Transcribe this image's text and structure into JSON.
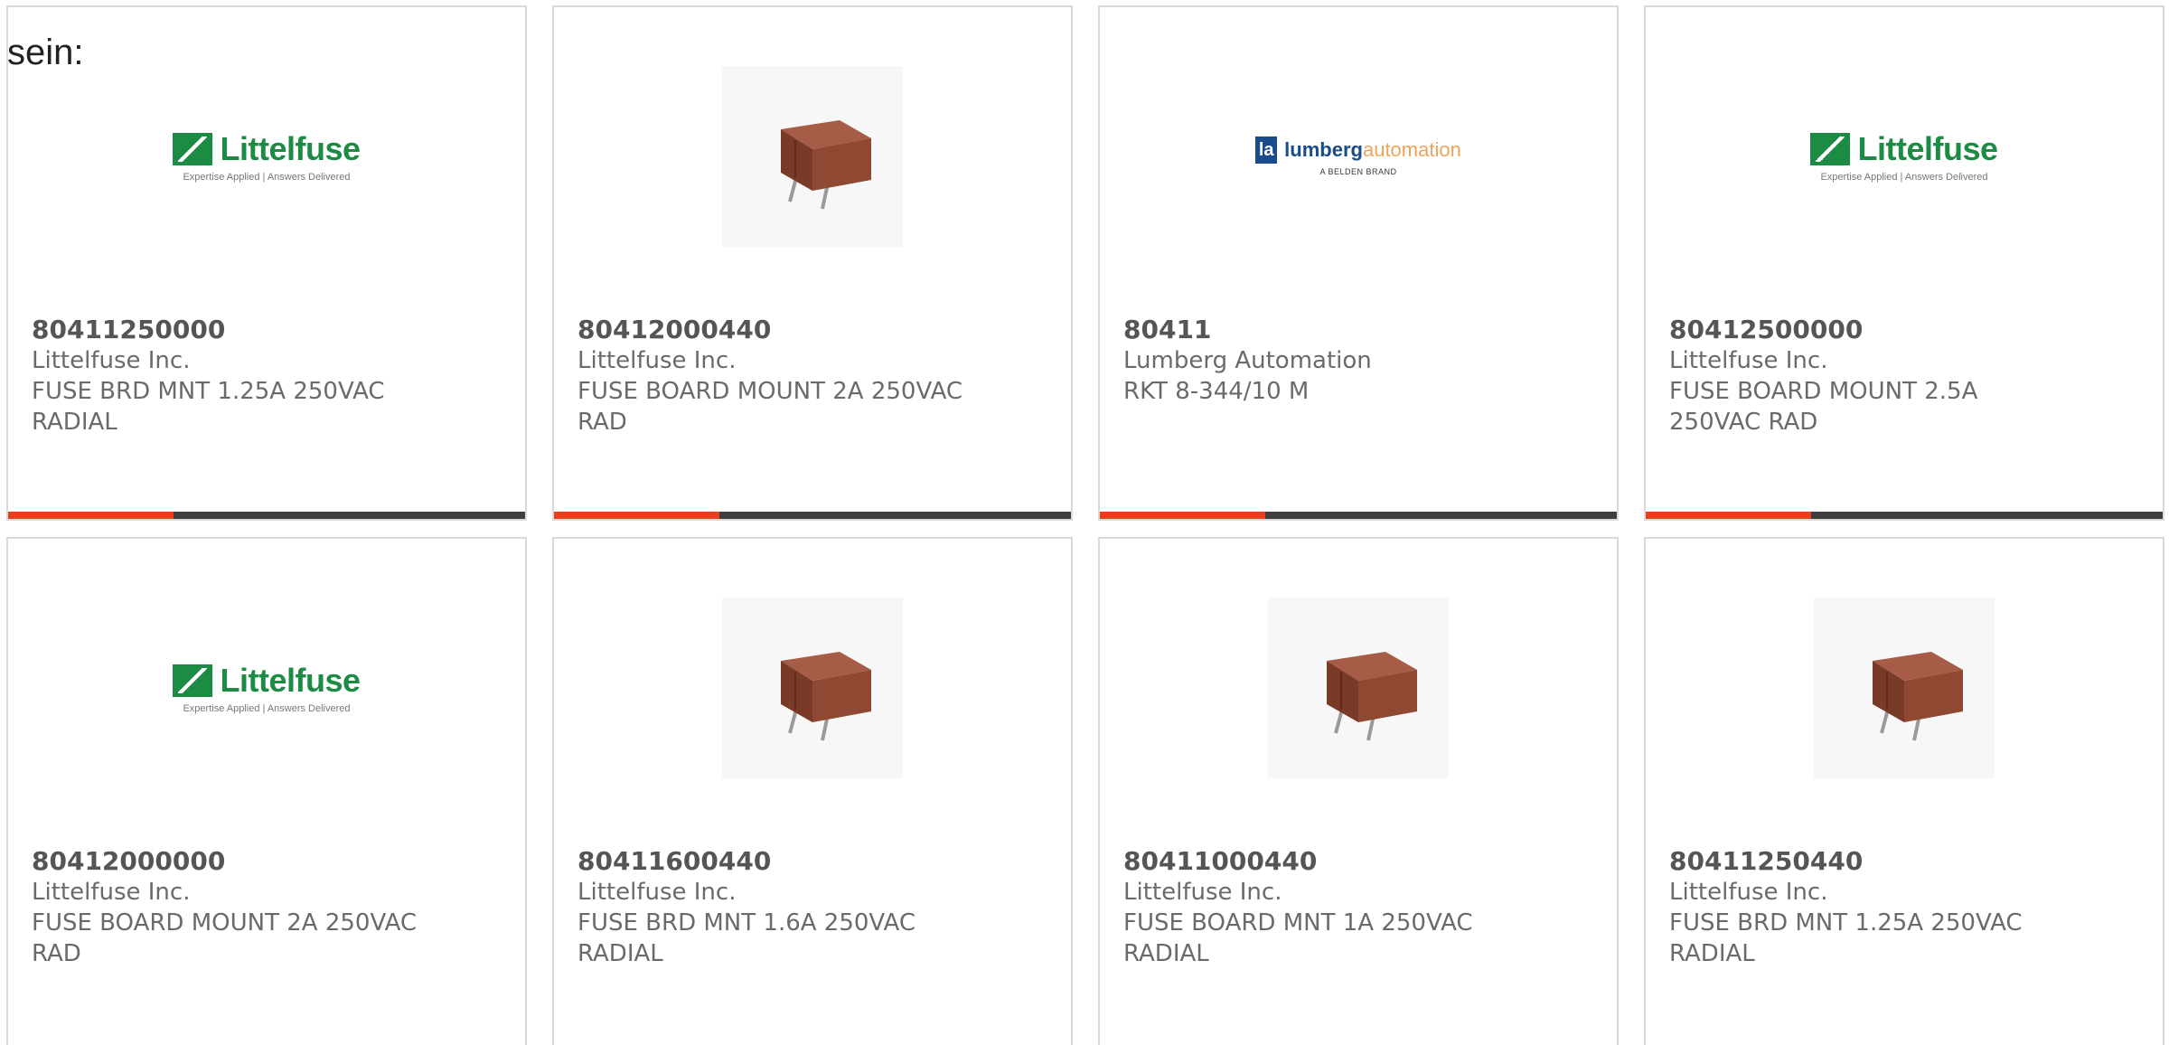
{
  "intro_text": "sein:",
  "accent_color": "#e8401c",
  "bar_color": "#3f3f3f",
  "products": [
    {
      "part": "80411250000",
      "maker": "Littelfuse Inc.",
      "desc_line1": "FUSE BRD MNT 1.25A 250VAC",
      "desc_line2": "RADIAL",
      "image": "littelfuse-logo"
    },
    {
      "part": "80412000440",
      "maker": "Littelfuse Inc.",
      "desc_line1": "FUSE BOARD MOUNT 2A 250VAC",
      "desc_line2": "RAD",
      "image": "fuse-photo"
    },
    {
      "part": "80411",
      "maker": "Lumberg Automation",
      "desc_line1": "RKT 8-344/10 M",
      "desc_line2": "",
      "image": "lumberg-logo"
    },
    {
      "part": "80412500000",
      "maker": "Littelfuse Inc.",
      "desc_line1": "FUSE BOARD MOUNT 2.5A",
      "desc_line2": "250VAC RAD",
      "image": "littelfuse-logo"
    },
    {
      "part": "80412000000",
      "maker": "Littelfuse Inc.",
      "desc_line1": "FUSE BOARD MOUNT 2A 250VAC",
      "desc_line2": "RAD",
      "image": "littelfuse-logo"
    },
    {
      "part": "80411600440",
      "maker": "Littelfuse Inc.",
      "desc_line1": "FUSE BRD MNT 1.6A 250VAC",
      "desc_line2": "RADIAL",
      "image": "fuse-photo"
    },
    {
      "part": "80411000440",
      "maker": "Littelfuse Inc.",
      "desc_line1": "FUSE BOARD MNT 1A 250VAC",
      "desc_line2": "RADIAL",
      "image": "fuse-photo"
    },
    {
      "part": "80411250440",
      "maker": "Littelfuse Inc.",
      "desc_line1": "FUSE BRD MNT 1.25A 250VAC",
      "desc_line2": "RADIAL",
      "image": "fuse-photo"
    }
  ],
  "logos": {
    "littelfuse_word": "Littelfuse",
    "littelfuse_tag": "Expertise Applied | Answers Delivered",
    "lumberg_mark": "la",
    "lumberg_word1": "lumberg",
    "lumberg_word2": "automation",
    "lumberg_tag": "A BELDEN BRAND"
  }
}
